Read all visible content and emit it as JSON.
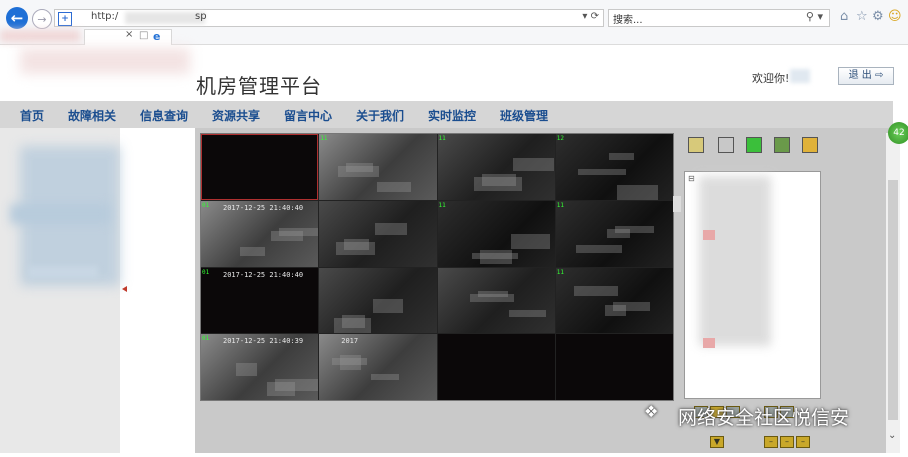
{
  "browser": {
    "url_prefix": "http:/",
    "url_suffix": "sp",
    "search_placeholder": "搜索...",
    "address_controls": "▾ ⟳",
    "search_arrow": "▾"
  },
  "header": {
    "title": "机房管理平台",
    "welcome": "欢迎你!",
    "logout_label": "退 出"
  },
  "nav": {
    "items": [
      "首页",
      "故障相关",
      "信息查询",
      "资源共享",
      "留言中心",
      "关于我们",
      "实时监控",
      "班级管理"
    ]
  },
  "cameras": [
    {
      "state": "off",
      "num": "",
      "ts": ""
    },
    {
      "state": "cam",
      "num": "11",
      "ts": ""
    },
    {
      "state": "cam",
      "num": "11",
      "ts": ""
    },
    {
      "state": "cam",
      "num": "12",
      "ts": ""
    },
    {
      "state": "cam",
      "num": "01",
      "ts": "2017-12-25 21:40:40"
    },
    {
      "state": "cam",
      "num": "",
      "ts": ""
    },
    {
      "state": "cam",
      "num": "11",
      "ts": ""
    },
    {
      "state": "cam",
      "num": "11",
      "ts": ""
    },
    {
      "state": "off",
      "num": "01",
      "ts": "2017-12-25 21:40:40"
    },
    {
      "state": "cam",
      "num": "",
      "ts": ""
    },
    {
      "state": "cam",
      "num": "",
      "ts": ""
    },
    {
      "state": "cam",
      "num": "11",
      "ts": ""
    },
    {
      "state": "cam",
      "num": "01",
      "ts": "2017-12-25 21:40:39"
    },
    {
      "state": "cam",
      "num": "",
      "ts": "2017"
    },
    {
      "state": "off",
      "num": "",
      "ts": ""
    },
    {
      "state": "off",
      "num": "",
      "ts": ""
    }
  ],
  "tree": {
    "root_glyph": "⊟"
  },
  "watermark": {
    "text": "网络安全社区悦信安"
  },
  "badge": {
    "text": "42"
  },
  "colors": {
    "nav_text": "#1a4d8f",
    "back_button": "#1e6fd6",
    "camera_label": "#33ff33"
  }
}
